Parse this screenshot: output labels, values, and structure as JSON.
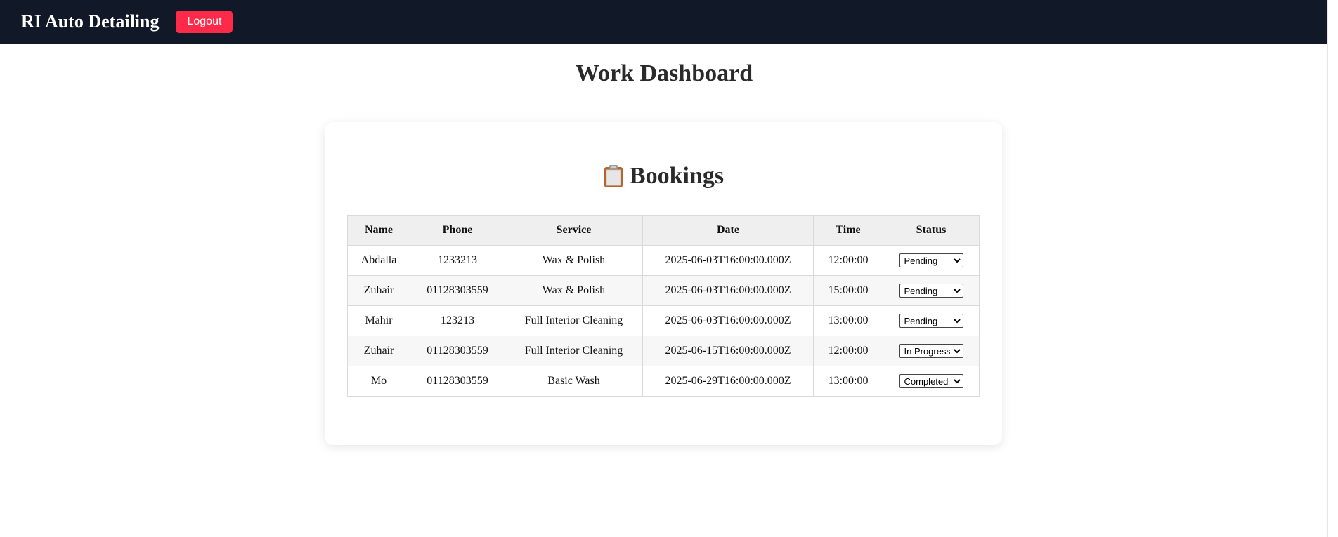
{
  "header": {
    "brand": "RI Auto Detailing",
    "logout_label": "Logout"
  },
  "page": {
    "title": "Work Dashboard"
  },
  "bookings": {
    "title": "Bookings",
    "icon": "clipboard-icon",
    "columns": [
      "Name",
      "Phone",
      "Service",
      "Date",
      "Time",
      "Status"
    ],
    "status_options": [
      "Pending",
      "In Progress",
      "Completed"
    ],
    "rows": [
      {
        "name": "Abdalla",
        "phone": "1233213",
        "service": "Wax & Polish",
        "date": "2025-06-03T16:00:00.000Z",
        "time": "12:00:00",
        "status": "Pending"
      },
      {
        "name": "Zuhair",
        "phone": "01128303559",
        "service": "Wax & Polish",
        "date": "2025-06-03T16:00:00.000Z",
        "time": "15:00:00",
        "status": "Pending"
      },
      {
        "name": "Mahir",
        "phone": "123213",
        "service": "Full Interior Cleaning",
        "date": "2025-06-03T16:00:00.000Z",
        "time": "13:00:00",
        "status": "Pending"
      },
      {
        "name": "Zuhair",
        "phone": "01128303559",
        "service": "Full Interior Cleaning",
        "date": "2025-06-15T16:00:00.000Z",
        "time": "12:00:00",
        "status": "In Progress"
      },
      {
        "name": "Mo",
        "phone": "01128303559",
        "service": "Basic Wash",
        "date": "2025-06-29T16:00:00.000Z",
        "time": "13:00:00",
        "status": "Completed"
      }
    ]
  },
  "colors": {
    "navbar": "#111827",
    "logout_button": "#ff2a4a"
  }
}
